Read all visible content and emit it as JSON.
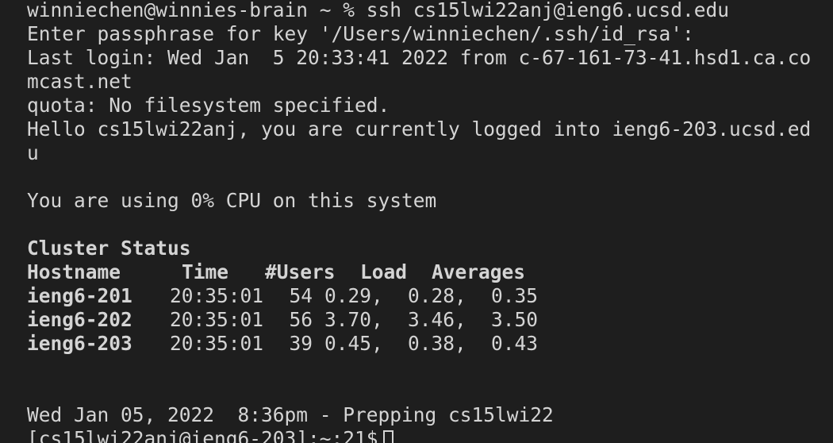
{
  "terminal": {
    "prompt_line": "winniechen@winnies-brain ~ % ssh cs15lwi22anj@ieng6.ucsd.edu",
    "passphrase_line": "Enter passphrase for key '/Users/winniechen/.ssh/id_rsa':",
    "last_login_line1": "Last login: Wed Jan  5 20:33:41 2022 from c-67-161-73-41.hsd1.ca.co",
    "last_login_line2": "mcast.net",
    "quota_line": "quota: No filesystem specified.",
    "hello_line1": "Hello cs15lwi22anj, you are currently logged into ieng6-203.ucsd.ed",
    "hello_line2": "u",
    "cpu_line": "You are using 0% CPU on this system",
    "cluster_title": "Cluster Status",
    "cluster_header": {
      "hostname": "Hostname",
      "time": "Time",
      "users": "#Users",
      "load": "Load",
      "averages": "Averages"
    },
    "cluster_rows": [
      {
        "host": "ieng6-201",
        "time": "20:35:01",
        "users": "54",
        "a1": "0.29,",
        "a2": "0.28,",
        "a3": "0.35"
      },
      {
        "host": "ieng6-202",
        "time": "20:35:01",
        "users": "56",
        "a1": "3.70,",
        "a2": "3.46,",
        "a3": "3.50"
      },
      {
        "host": "ieng6-203",
        "time": "20:35:01",
        "users": "39",
        "a1": "0.45,",
        "a2": "0.38,",
        "a3": "0.43"
      }
    ],
    "date_line": "Wed Jan 05, 2022  8:36pm - Prepping cs15lwi22",
    "final_prompt": "[cs15lwi22anj@ieng6-203]:~:21$"
  }
}
